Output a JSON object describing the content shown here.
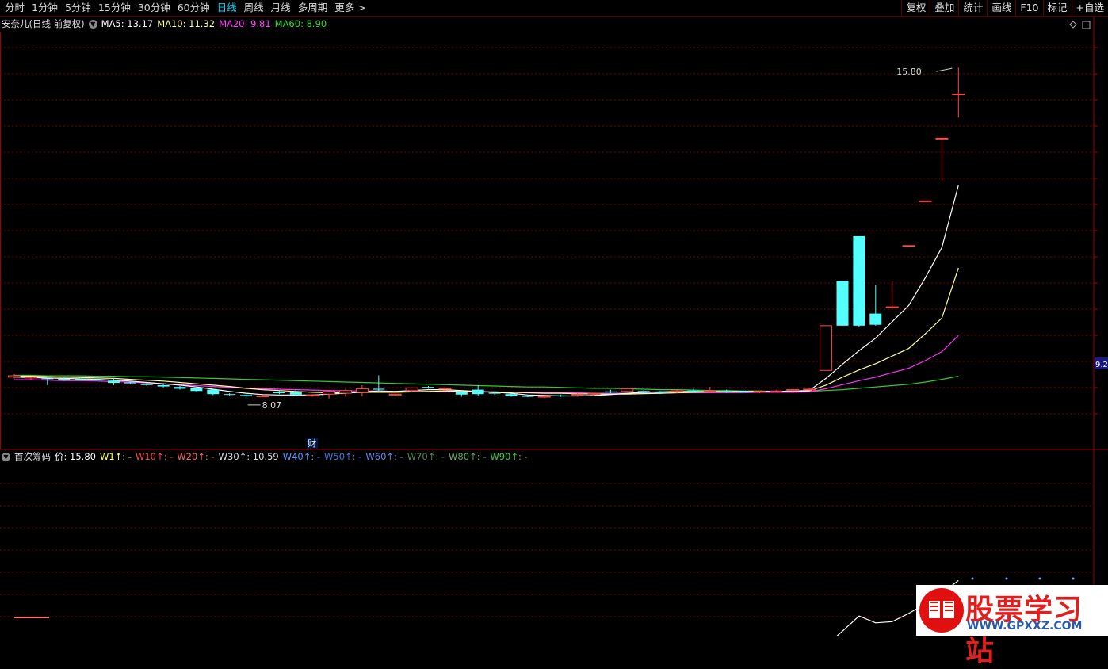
{
  "toolbar": {
    "periods": [
      "分时",
      "1分钟",
      "5分钟",
      "15分钟",
      "30分钟",
      "60分钟",
      "日线",
      "周线",
      "月线",
      "多周期",
      "更多 >"
    ],
    "active": "日线",
    "right": [
      "复权",
      "叠加",
      "统计",
      "画线",
      "F10",
      "标记",
      "+自选"
    ]
  },
  "main_info": {
    "stock": "安奈儿(日线 前复权)",
    "ma5": "MA5: 13.17",
    "ma10": "MA10: 11.32",
    "ma20": "MA20: 9.81",
    "ma60": "MA60: 8.90"
  },
  "sub_info": {
    "name": "首次筹码",
    "price": "价: 15.80",
    "w1": "W1↑: -",
    "w10": "W10↑: -",
    "w20": "W20↑: -",
    "w30": "W30↑: 10.59",
    "w40": "W40↑: -",
    "w50": "W50↑: -",
    "w60": "W60↑: -",
    "w70": "W70↑: -",
    "w80": "W80↑: -",
    "w90": "W90↑: -"
  },
  "colors": {
    "up": "#ff4a4a",
    "down": "#54ffff",
    "ma5": "#ffffff",
    "ma10": "#ffff99",
    "ma20": "#ff33ff",
    "ma60": "#33cc33",
    "grid": "#7a0000"
  },
  "annotations": {
    "high": "15.80",
    "low": "8.07",
    "event": "财",
    "axis_price": "9.2"
  },
  "watermark": {
    "text": "股票学习站",
    "url": "WWW.GPXXZ.COM"
  },
  "chart_data": {
    "type": "candlestick",
    "ylim": [
      7.6,
      16.6
    ],
    "candles": [
      [
        8.88,
        8.95,
        8.85,
        8.91
      ],
      [
        8.86,
        8.89,
        8.82,
        8.88
      ],
      [
        8.85,
        8.87,
        8.7,
        8.84
      ],
      [
        8.84,
        8.86,
        8.8,
        8.83
      ],
      [
        8.83,
        8.85,
        8.8,
        8.82
      ],
      [
        8.82,
        8.84,
        8.79,
        8.81
      ],
      [
        8.8,
        8.85,
        8.7,
        8.75
      ],
      [
        8.76,
        8.8,
        8.72,
        8.74
      ],
      [
        8.72,
        8.74,
        8.68,
        8.71
      ],
      [
        8.7,
        8.74,
        8.65,
        8.67
      ],
      [
        8.66,
        8.68,
        8.6,
        8.62
      ],
      [
        8.64,
        8.66,
        8.56,
        8.57
      ],
      [
        8.6,
        8.62,
        8.48,
        8.5
      ],
      [
        8.5,
        8.52,
        8.47,
        8.49
      ],
      [
        8.48,
        8.52,
        8.4,
        8.45
      ],
      [
        8.46,
        8.48,
        8.44,
        8.46
      ],
      [
        8.55,
        8.58,
        8.5,
        8.52
      ],
      [
        8.54,
        8.6,
        8.46,
        8.49
      ],
      [
        8.47,
        8.5,
        8.44,
        8.48
      ],
      [
        8.5,
        8.58,
        8.4,
        8.56
      ],
      [
        8.52,
        8.62,
        8.44,
        8.58
      ],
      [
        8.55,
        8.7,
        8.45,
        8.62
      ],
      [
        8.62,
        8.92,
        8.55,
        8.6
      ],
      [
        8.48,
        8.51,
        8.44,
        8.5
      ],
      [
        8.58,
        8.65,
        8.55,
        8.64
      ],
      [
        8.66,
        8.68,
        8.62,
        8.65
      ],
      [
        8.62,
        8.66,
        8.56,
        8.63
      ],
      [
        8.55,
        8.57,
        8.44,
        8.49
      ],
      [
        8.6,
        8.7,
        8.45,
        8.5
      ],
      [
        8.53,
        8.56,
        8.49,
        8.51
      ],
      [
        8.5,
        8.52,
        8.44,
        8.45
      ],
      [
        8.46,
        8.49,
        8.43,
        8.44
      ],
      [
        8.44,
        8.47,
        8.41,
        8.45
      ],
      [
        8.47,
        8.49,
        8.44,
        8.46
      ],
      [
        8.49,
        8.52,
        8.45,
        8.5
      ],
      [
        8.51,
        8.54,
        8.47,
        8.52
      ],
      [
        8.56,
        8.6,
        8.52,
        8.55
      ],
      [
        8.56,
        8.64,
        8.54,
        8.62
      ],
      [
        8.57,
        8.59,
        8.52,
        8.54
      ],
      [
        8.54,
        8.57,
        8.5,
        8.53
      ],
      [
        8.56,
        8.6,
        8.52,
        8.57
      ],
      [
        8.58,
        8.62,
        8.54,
        8.55
      ],
      [
        8.56,
        8.66,
        8.54,
        8.57
      ],
      [
        8.57,
        8.6,
        8.53,
        8.55
      ],
      [
        8.56,
        8.59,
        8.52,
        8.55
      ],
      [
        8.55,
        8.58,
        8.52,
        8.56
      ],
      [
        8.56,
        8.59,
        8.53,
        8.57
      ],
      [
        8.58,
        8.61,
        8.55,
        8.6
      ],
      [
        8.6,
        8.63,
        8.58,
        8.61
      ],
      [
        9.03,
        10.03,
        9.03,
        10.03
      ],
      [
        11.03,
        11.03,
        10.03,
        10.03
      ],
      [
        12.03,
        12.03,
        10.0,
        10.03
      ],
      [
        10.3,
        10.95,
        10.03,
        10.05
      ],
      [
        10.45,
        11.03,
        10.45,
        10.45
      ],
      [
        11.82,
        11.82,
        11.82,
        11.82
      ],
      [
        12.82,
        12.82,
        12.82,
        12.82
      ],
      [
        14.22,
        14.22,
        13.25,
        14.22
      ],
      [
        15.21,
        15.8,
        14.68,
        15.21
      ]
    ],
    "ma5": [
      8.88,
      8.87,
      8.86,
      8.85,
      8.84,
      8.83,
      8.81,
      8.79,
      8.76,
      8.73,
      8.7,
      8.66,
      8.61,
      8.56,
      8.52,
      8.49,
      8.48,
      8.48,
      8.48,
      8.5,
      8.52,
      8.55,
      8.57,
      8.56,
      8.58,
      8.6,
      8.6,
      8.58,
      8.56,
      8.54,
      8.52,
      8.48,
      8.47,
      8.46,
      8.46,
      8.47,
      8.49,
      8.52,
      8.54,
      8.55,
      8.56,
      8.56,
      8.56,
      8.56,
      8.56,
      8.56,
      8.56,
      8.57,
      8.58,
      8.85,
      9.17,
      9.47,
      9.75,
      10.12,
      10.48,
      11.1,
      11.78,
      13.17
    ],
    "ma10": [
      8.9,
      8.9,
      8.89,
      8.88,
      8.87,
      8.86,
      8.85,
      8.83,
      8.81,
      8.79,
      8.76,
      8.73,
      8.7,
      8.67,
      8.63,
      8.6,
      8.58,
      8.56,
      8.54,
      8.53,
      8.53,
      8.54,
      8.54,
      8.54,
      8.55,
      8.56,
      8.57,
      8.56,
      8.55,
      8.55,
      8.54,
      8.53,
      8.52,
      8.52,
      8.51,
      8.5,
      8.5,
      8.5,
      8.51,
      8.52,
      8.53,
      8.54,
      8.55,
      8.55,
      8.55,
      8.56,
      8.56,
      8.56,
      8.57,
      8.7,
      8.88,
      9.04,
      9.18,
      9.35,
      9.52,
      9.85,
      10.2,
      11.32
    ],
    "ma20": [
      8.82,
      8.82,
      8.81,
      8.8,
      8.8,
      8.79,
      8.78,
      8.77,
      8.75,
      8.73,
      8.71,
      8.69,
      8.67,
      8.65,
      8.63,
      8.62,
      8.61,
      8.6,
      8.59,
      8.58,
      8.57,
      8.57,
      8.57,
      8.56,
      8.56,
      8.56,
      8.56,
      8.55,
      8.55,
      8.54,
      8.54,
      8.54,
      8.53,
      8.53,
      8.53,
      8.52,
      8.52,
      8.52,
      8.52,
      8.52,
      8.53,
      8.53,
      8.53,
      8.53,
      8.53,
      8.54,
      8.54,
      8.54,
      8.55,
      8.62,
      8.71,
      8.8,
      8.88,
      8.98,
      9.08,
      9.25,
      9.45,
      9.81
    ],
    "ma60": [
      8.92,
      8.92,
      8.91,
      8.91,
      8.91,
      8.9,
      8.9,
      8.89,
      8.89,
      8.88,
      8.87,
      8.86,
      8.85,
      8.84,
      8.83,
      8.82,
      8.81,
      8.8,
      8.79,
      8.78,
      8.77,
      8.76,
      8.75,
      8.74,
      8.73,
      8.72,
      8.71,
      8.7,
      8.69,
      8.68,
      8.67,
      8.66,
      8.66,
      8.65,
      8.64,
      8.63,
      8.63,
      8.62,
      8.61,
      8.6,
      8.6,
      8.59,
      8.58,
      8.58,
      8.57,
      8.57,
      8.56,
      8.56,
      8.56,
      8.58,
      8.6,
      8.63,
      8.66,
      8.69,
      8.72,
      8.77,
      8.83,
      8.9
    ],
    "w30": [
      8.84,
      8.84,
      8.83,
      8.83,
      8.82,
      8.82,
      8.81,
      8.8,
      8.79,
      8.78,
      8.77,
      8.76,
      8.74,
      8.72,
      8.7,
      8.69,
      8.68,
      8.67,
      8.66,
      8.66,
      8.65,
      8.65,
      8.64,
      8.64,
      8.63,
      8.63,
      8.62,
      8.62,
      8.61,
      8.61,
      8.6,
      8.6,
      8.59,
      8.59,
      8.58,
      8.58,
      8.58,
      8.58,
      8.58,
      8.58,
      8.58,
      8.58,
      8.58,
      8.58,
      8.58,
      8.58,
      8.58,
      8.59,
      8.59,
      8.59,
      9.2,
      9.84,
      9.55,
      9.6,
      9.95,
      10.35,
      10.8,
      11.35
    ]
  }
}
